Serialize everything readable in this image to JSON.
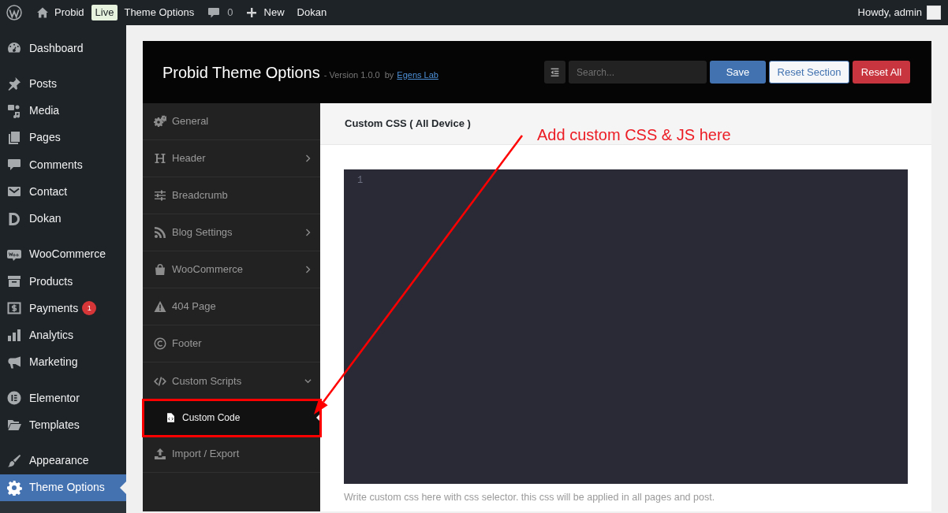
{
  "admin_bar": {
    "site_name": "Probid",
    "live_badge": "Live",
    "page_link": "Theme Options",
    "comments_count": "0",
    "new_link": "New",
    "plugin_link": "Dokan",
    "greeting": "Howdy, admin"
  },
  "admin_menu": [
    {
      "items": [
        {
          "label": "Dashboard",
          "selected": false
        }
      ]
    },
    {
      "items": [
        {
          "label": "Posts",
          "selected": false
        },
        {
          "label": "Media",
          "selected": false
        },
        {
          "label": "Pages",
          "selected": false
        },
        {
          "label": "Comments",
          "selected": false
        },
        {
          "label": "Contact",
          "selected": false
        },
        {
          "label": "Dokan",
          "selected": false
        }
      ]
    },
    {
      "items": [
        {
          "label": "WooCommerce",
          "selected": false
        },
        {
          "label": "Products",
          "selected": false
        },
        {
          "label": "Payments",
          "selected": false,
          "badge": "1"
        },
        {
          "label": "Analytics",
          "selected": false
        },
        {
          "label": "Marketing",
          "selected": false
        }
      ]
    },
    {
      "items": [
        {
          "label": "Elementor",
          "selected": false
        },
        {
          "label": "Templates",
          "selected": false
        }
      ]
    },
    {
      "items": [
        {
          "label": "Appearance",
          "selected": false
        },
        {
          "label": "Theme Options",
          "selected": true
        }
      ]
    }
  ],
  "theme_options": {
    "title": "Probid Theme Options",
    "version": "- Version 1.0.0",
    "by": "by",
    "author_link": "Egens Lab",
    "search": {
      "placeholder": "Search..."
    },
    "buttons": [
      {
        "label": "Save",
        "kind": "primary"
      },
      {
        "label": "Reset Section",
        "kind": "secondary"
      },
      {
        "label": "Reset All",
        "kind": "danger"
      }
    ],
    "nav": [
      {
        "label": "General",
        "kind": "link",
        "selected": false
      },
      {
        "label": "Header",
        "kind": "group",
        "expanded": false,
        "selected": false
      },
      {
        "label": "Breadcrumb",
        "kind": "link",
        "selected": false
      },
      {
        "label": "Blog Settings",
        "kind": "group",
        "expanded": false,
        "selected": false
      },
      {
        "label": "WooCommerce",
        "kind": "group",
        "expanded": false,
        "selected": false
      },
      {
        "label": "404 Page",
        "kind": "link",
        "selected": false
      },
      {
        "label": "Footer",
        "kind": "link",
        "selected": false
      },
      {
        "label": "Custom Scripts",
        "kind": "group",
        "expanded": true,
        "selected": false,
        "children": [
          {
            "label": "Custom Code",
            "selected": true
          }
        ]
      },
      {
        "label": "Import / Export",
        "kind": "link",
        "selected": false
      }
    ],
    "section": {
      "title": "Custom CSS ( All Device )",
      "line_numbers": [
        "1"
      ],
      "description": "Write custom css here with css selector. this css will be applied in all pages and post."
    }
  },
  "annotation": {
    "text": "Add custom CSS & JS here"
  }
}
